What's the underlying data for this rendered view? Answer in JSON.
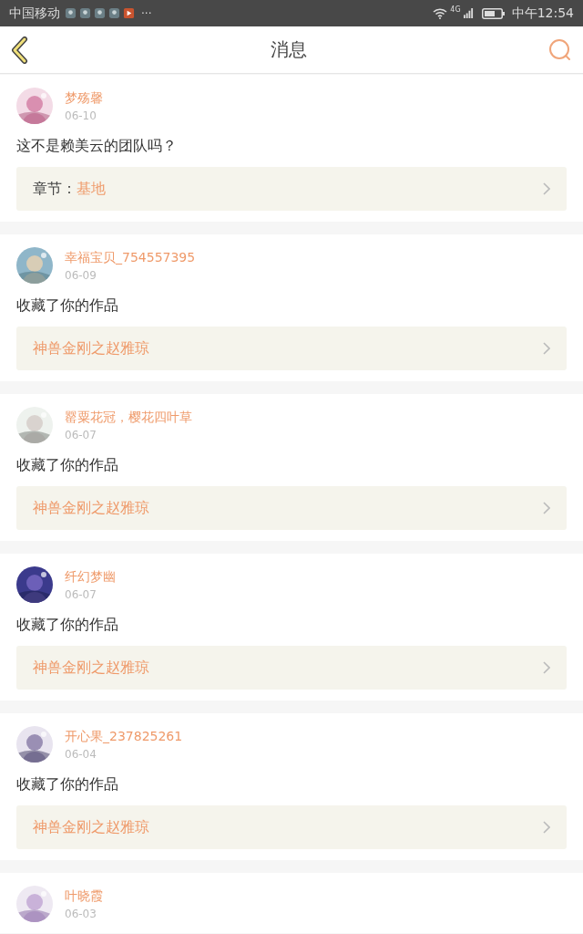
{
  "status_bar": {
    "carrier": "中国移动",
    "more": "···",
    "network": "4G",
    "time": "中午12:54"
  },
  "header": {
    "title": "消息"
  },
  "messages": [
    {
      "user": "梦殇馨",
      "date": "06-10",
      "text": "这不是赖美云的团队吗？",
      "link": {
        "prefix": "章节：",
        "title": "基地"
      }
    },
    {
      "user": "幸福宝贝_754557395",
      "date": "06-09",
      "text": "收藏了你的作品",
      "link": {
        "title": "神兽金刚之赵雅琼"
      }
    },
    {
      "user": "罂粟花冠，樱花四叶草",
      "date": "06-07",
      "text": "收藏了你的作品",
      "link": {
        "title": "神兽金刚之赵雅琼"
      }
    },
    {
      "user": "纤幻梦幽",
      "date": "06-07",
      "text": "收藏了你的作品",
      "link": {
        "title": "神兽金刚之赵雅琼"
      }
    },
    {
      "user": "开心果_237825261",
      "date": "06-04",
      "text": "收藏了你的作品",
      "link": {
        "title": "神兽金刚之赵雅琼"
      }
    },
    {
      "user": "叶晓霞",
      "date": "06-03"
    }
  ]
}
